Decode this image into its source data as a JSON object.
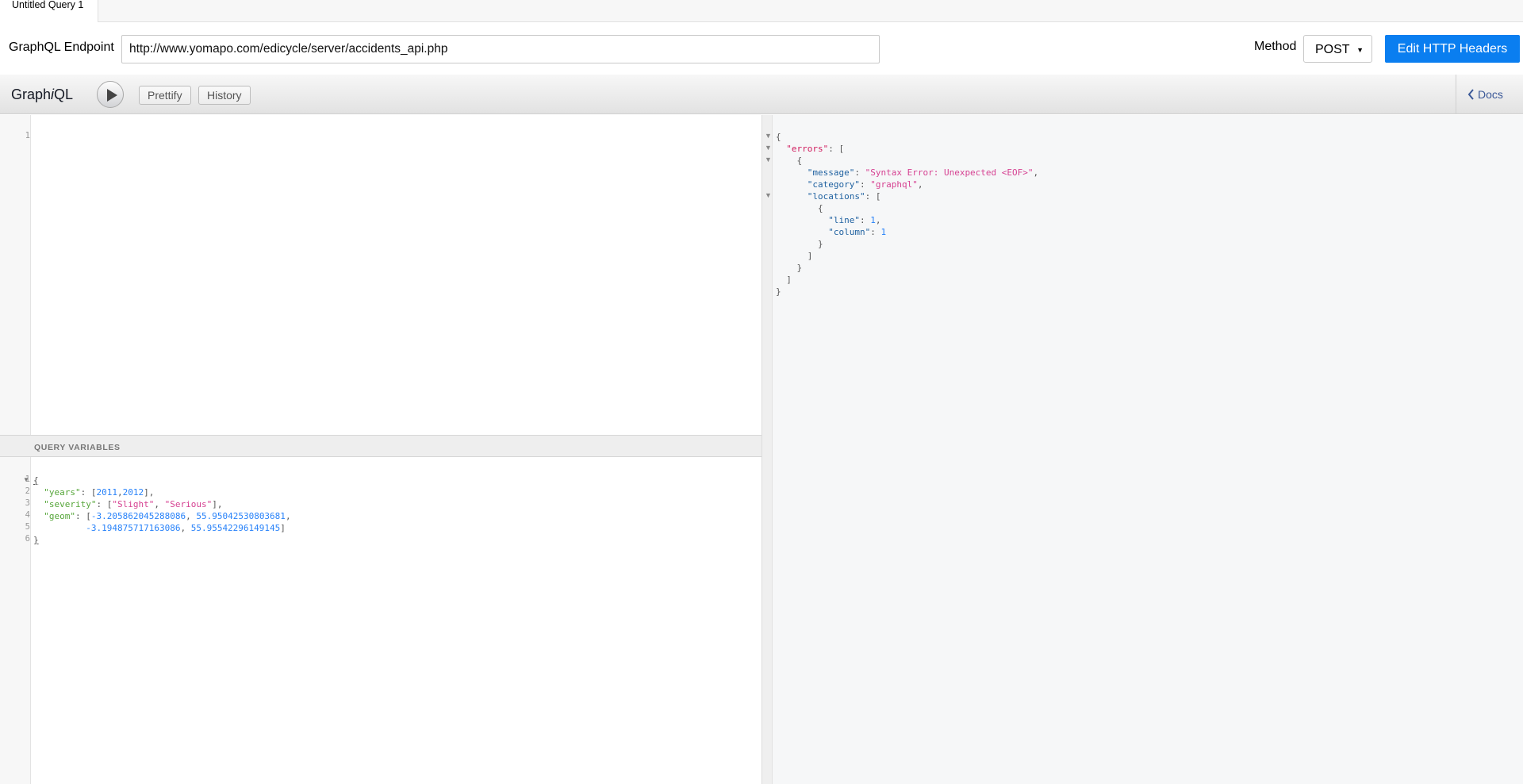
{
  "tab": {
    "title": "Untitled Query 1"
  },
  "endpoint": {
    "label": "GraphQL Endpoint",
    "url": "http://www.yomapo.com/edicycle/server/accidents_api.php",
    "method_label": "Method",
    "method_value": "POST",
    "edit_headers_label": "Edit HTTP Headers"
  },
  "toolbar": {
    "title_prefix": "Graph",
    "title_italic": "i",
    "title_suffix": "QL",
    "prettify_label": "Prettify",
    "history_label": "History",
    "docs_label": "Docs"
  },
  "query_editor": {
    "line_numbers": [
      "1"
    ]
  },
  "variables": {
    "header": "QUERY VARIABLES",
    "line_numbers": [
      "1",
      "2",
      "3",
      "4",
      "5",
      "6"
    ],
    "years_key": "\"years\"",
    "years": [
      "2011",
      "2012"
    ],
    "severity_key": "\"severity\"",
    "severity": [
      "\"Slight\"",
      "\"Serious\""
    ],
    "geom_key": "\"geom\"",
    "geom": [
      "-3.205862045288086",
      "55.95042530803681",
      "-3.194875717163086",
      "55.95542296149145"
    ]
  },
  "result": {
    "errors_key": "\"errors\"",
    "message_key": "\"message\"",
    "message_value": "\"Syntax Error: Unexpected <EOF>\"",
    "category_key": "\"category\"",
    "category_value": "\"graphql\"",
    "locations_key": "\"locations\"",
    "line_key": "\"line\"",
    "line_value": "1",
    "column_key": "\"column\"",
    "column_value": "1"
  },
  "icons": {
    "execute": "play-icon",
    "docs": "chevron-left-icon",
    "method": "caret-down-icon",
    "fold": "fold-arrow-icon"
  },
  "colors": {
    "accent": "#0a7ef0",
    "docs_link": "#3b5998",
    "json_key": "#1f61a0",
    "json_string": "#d64292",
    "json_number": "#2882f9",
    "error_key": "#d01c5e"
  }
}
